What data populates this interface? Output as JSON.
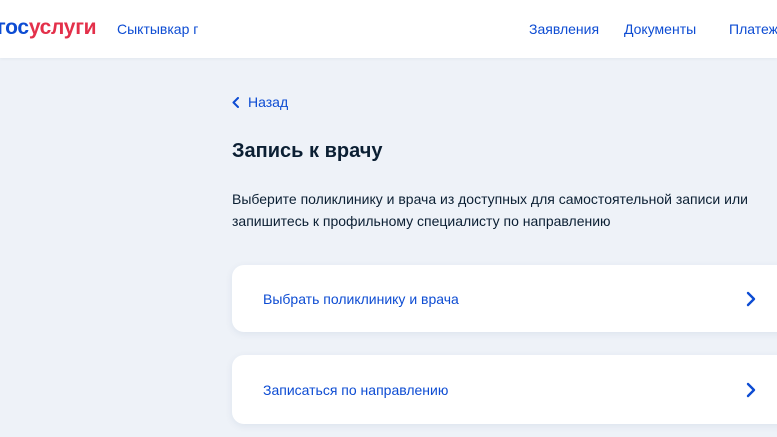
{
  "header": {
    "logo_part_a": "гос",
    "logo_part_b": "услуги",
    "city": "Сыктывкар г",
    "nav": [
      "Заявления",
      "Документы",
      "Платежи"
    ]
  },
  "page": {
    "back_label": "Назад",
    "title": "Запись к врачу",
    "description": "Выберите поликлинику и врача из доступных для самостоятельной записи или запишитесь к профильному специалисту по направлению"
  },
  "options": [
    {
      "label": "Выбрать поликлинику и врача",
      "icon": "chevron-right-icon"
    },
    {
      "label": "Записаться по направлению",
      "icon": "chevron-right-icon"
    }
  ],
  "colors": {
    "accent": "#0d4cd3",
    "brand_red": "#e3304a",
    "background": "#eef2f8",
    "text": "#0b1f33"
  }
}
